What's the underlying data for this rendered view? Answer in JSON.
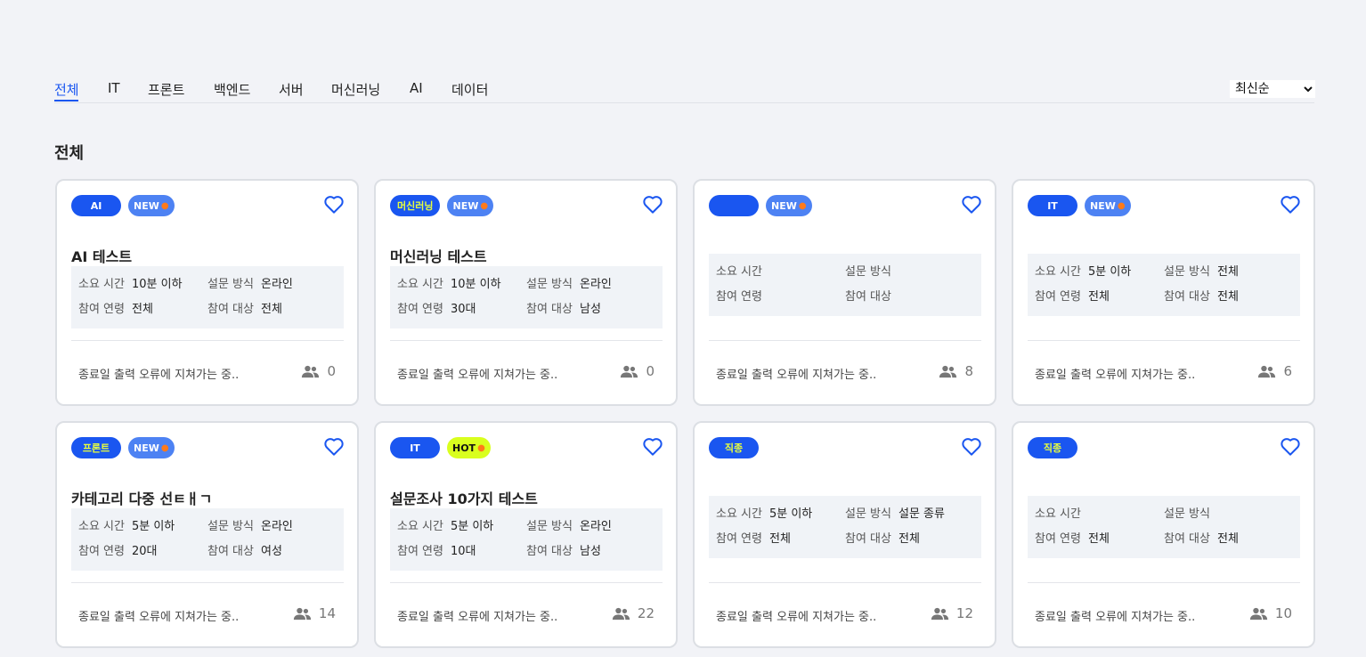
{
  "tabs": [
    {
      "label": "전체",
      "active": true
    },
    {
      "label": "IT"
    },
    {
      "label": "프론트"
    },
    {
      "label": "백엔드"
    },
    {
      "label": "서버"
    },
    {
      "label": "머신러닝"
    },
    {
      "label": "AI"
    },
    {
      "label": "데이터"
    }
  ],
  "sort": {
    "selected": "최신순"
  },
  "section_title": "전체",
  "labels": {
    "duration": "소요 시간",
    "method": "설문 방식",
    "age": "참여 연령",
    "target": "참여 대상",
    "new": "NEW",
    "hot": "HOT"
  },
  "cards": [
    {
      "category": "AI",
      "badge": "NEW",
      "title": "AI 테스트",
      "duration": "10분 이하",
      "method": "온라인",
      "age": "전체",
      "target": "전체",
      "footer": "종료일 출력 오류에 지쳐가는 중..",
      "count": "0"
    },
    {
      "category": "머신러닝",
      "badge": "NEW",
      "title": "머신러닝 테스트",
      "duration": "10분 이하",
      "method": "온라인",
      "age": "30대",
      "target": "남성",
      "footer": "종료일 출력 오류에 지쳐가는 중..",
      "count": "0"
    },
    {
      "category": "",
      "badge": "NEW",
      "title": "",
      "duration": "",
      "method": "",
      "age": "",
      "target": "",
      "footer": "종료일 출력 오류에 지쳐가는 중..",
      "count": "8"
    },
    {
      "category": "IT",
      "badge": "NEW",
      "title": "",
      "duration": "5분 이하",
      "method": "전체",
      "age": "전체",
      "target": "전체",
      "footer": "종료일 출력 오류에 지쳐가는 중..",
      "count": "6"
    },
    {
      "category": "프론트",
      "badge": "NEW",
      "title": "카테고리 다중 선ㅌㅐㄱ",
      "duration": "5분 이하",
      "method": "온라인",
      "age": "20대",
      "target": "여성",
      "footer": "종료일 출력 오류에 지쳐가는 중..",
      "count": "14"
    },
    {
      "category": "IT",
      "badge": "HOT",
      "title": "설문조사 10가지 테스트",
      "duration": "5분 이하",
      "method": "온라인",
      "age": "10대",
      "target": "남성",
      "footer": "종료일 출력 오류에 지쳐가는 중..",
      "count": "22"
    },
    {
      "category": "직종",
      "badge": "",
      "title": "",
      "duration": "5분 이하",
      "method": "설문 종류",
      "age": "전체",
      "target": "전체",
      "footer": "종료일 출력 오류에 지쳐가는 중..",
      "count": "12"
    },
    {
      "category": "직종",
      "badge": "",
      "title": "",
      "duration": "",
      "method": "",
      "age": "전체",
      "target": "전체",
      "footer": "종료일 출력 오류에 지쳐가는 중..",
      "count": "10"
    }
  ],
  "colors": {
    "accent": "#1a56f0",
    "new_badge": "#4d82f3",
    "hot_badge": "#d9ff1e",
    "background": "#f2f3f7"
  }
}
